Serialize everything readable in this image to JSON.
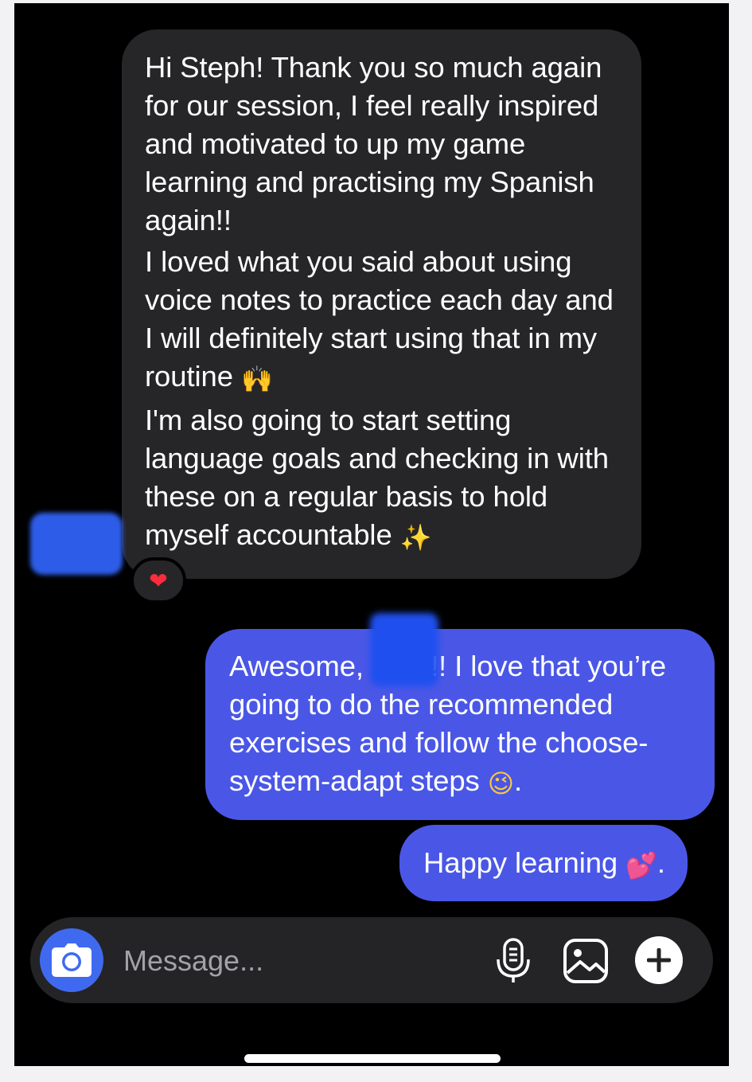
{
  "conversation": {
    "incoming_message": {
      "paragraph_1": "Hi Steph! Thank you so much again for our session, I feel really inspired and motivated to up my game learning and practising my Spanish again!!",
      "paragraph_2_text": "I loved what you said about using voice notes to practice each day and I will definitely start using that in my routine",
      "paragraph_2_emoji": "🙌",
      "paragraph_3_text": "I'm also going to start setting language goals and checking in with these on a regular basis to hold myself accountable",
      "paragraph_3_emoji": "✨",
      "reaction_emoji": "❤"
    },
    "outgoing_messages": [
      {
        "text_before_name": "Awesome, ",
        "text_after_name": "!! I love that you’re going to do the recommended exercises and follow the choose-system-adapt steps",
        "emoji": "😉",
        "suffix": "."
      },
      {
        "text": "Happy learning",
        "emoji": "💕",
        "suffix": "."
      }
    ]
  },
  "composer": {
    "placeholder": "Message...",
    "camera_icon": "camera-icon",
    "mic_icon": "microphone-icon",
    "gallery_icon": "gallery-icon",
    "plus_icon": "plus-icon"
  },
  "colors": {
    "background": "#000000",
    "incoming_bubble": "#262628",
    "outgoing_bubble": "#4a57e6",
    "camera_button": "#3f6af0",
    "composer": "#242426",
    "redaction": "#2d5de8"
  }
}
